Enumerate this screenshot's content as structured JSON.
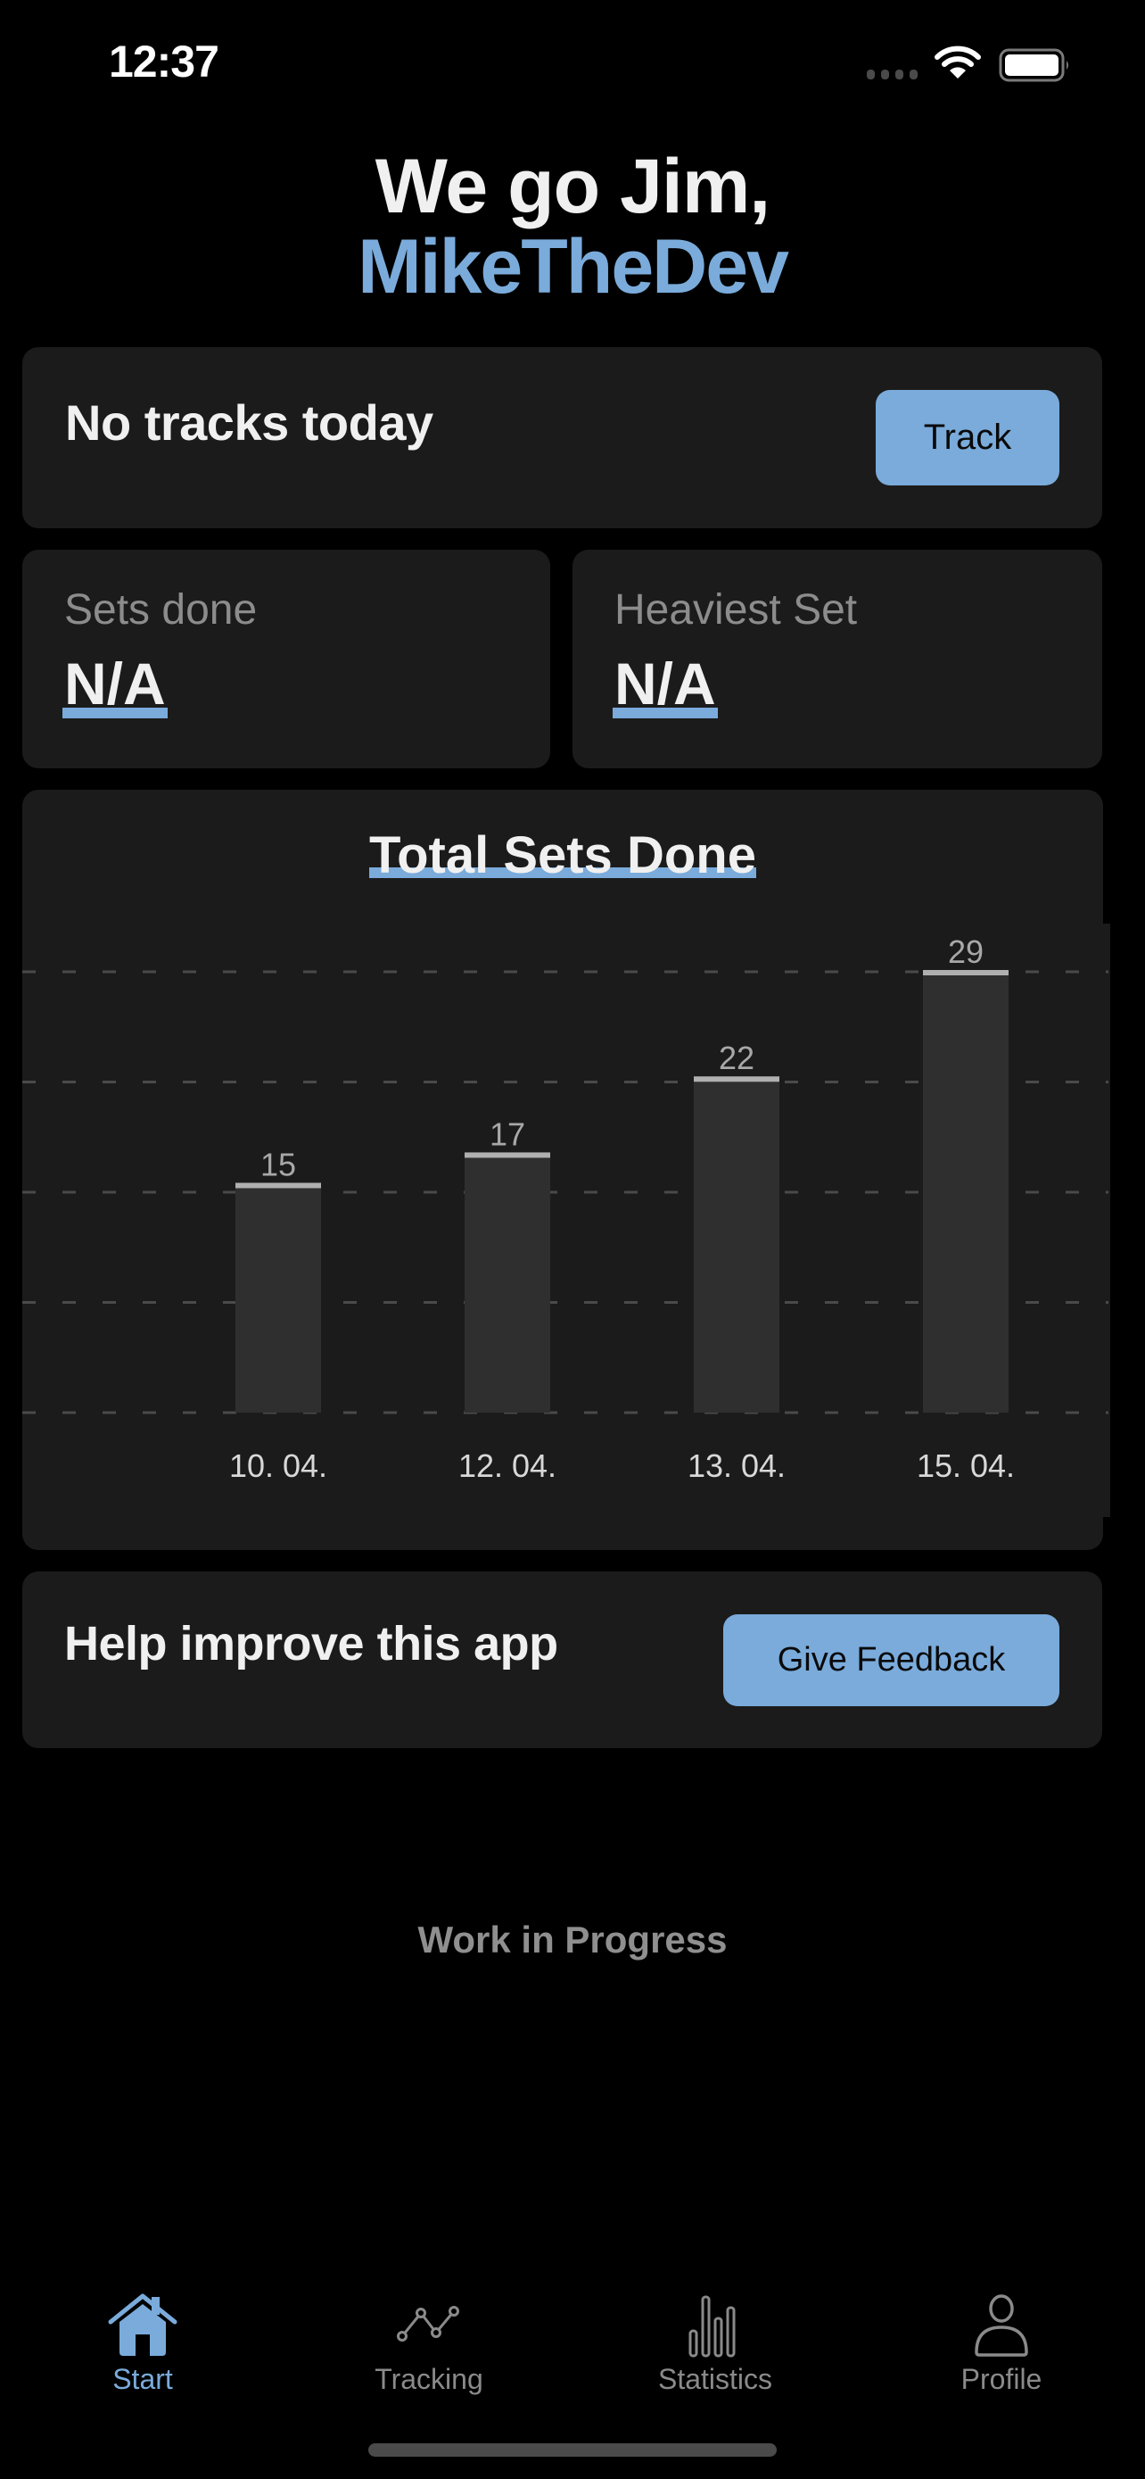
{
  "status_bar": {
    "time": "12:37",
    "icons": [
      "signal-dots-icon",
      "wifi-icon",
      "battery-icon"
    ]
  },
  "greeting": {
    "line1": "We go Jim,",
    "username": "MikeTheDev"
  },
  "today_card": {
    "title": "No tracks today",
    "button_label": "Track"
  },
  "stats": [
    {
      "label": "Sets done",
      "value": "N/A"
    },
    {
      "label": "Heaviest Set",
      "value": "N/A"
    }
  ],
  "feedback_card": {
    "title": "Help improve this app",
    "button_label": "Give Feedback"
  },
  "footer_note": "Work in Progress",
  "nav": [
    {
      "label": "Start",
      "icon": "home-icon",
      "active": true
    },
    {
      "label": "Tracking",
      "icon": "line-chart-icon",
      "active": false
    },
    {
      "label": "Statistics",
      "icon": "bar-chart-icon",
      "active": false
    },
    {
      "label": "Profile",
      "icon": "person-icon",
      "active": false
    }
  ],
  "colors": {
    "background": "#000000",
    "card": "#1b1b1b",
    "accent": "#7aabdb",
    "bar_fill": "#2f2f2f",
    "bar_cap": "#b0b0b0",
    "gridline": "#4a4a4a",
    "muted_text": "#8c8c8c"
  },
  "chart_data": {
    "type": "bar",
    "title": "Total Sets Done",
    "categories": [
      "10. 04.",
      "12. 04.",
      "13. 04.",
      "15. 04."
    ],
    "values": [
      15,
      17,
      22,
      29
    ],
    "xlabel": "",
    "ylabel": "",
    "ylim": [
      0,
      29
    ],
    "grid": true,
    "grid_lines": 5,
    "data_labels": true,
    "legend": "none"
  }
}
